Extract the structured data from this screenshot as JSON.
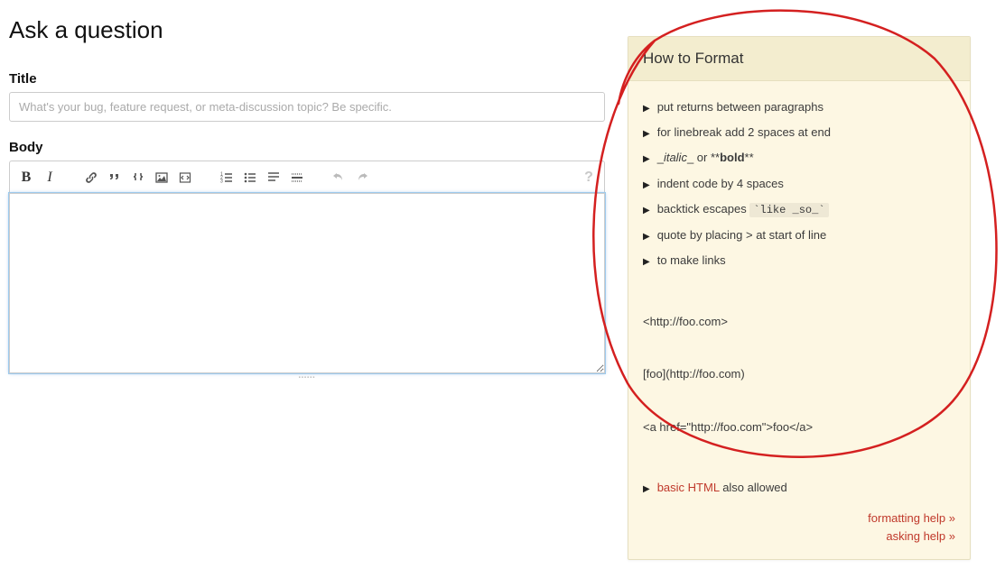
{
  "page": {
    "heading": "Ask a question"
  },
  "title_field": {
    "label": "Title",
    "placeholder": "What's your bug, feature request, or meta-discussion topic? Be specific."
  },
  "body_field": {
    "label": "Body"
  },
  "toolbar": {
    "bold_label": "B",
    "italic_label": "I",
    "help_glyph": "?"
  },
  "help_panel": {
    "title": "How to Format",
    "tips": {
      "t0": "put returns between paragraphs",
      "t1": "for linebreak add 2 spaces at end",
      "t2_pre": "_",
      "t2_italic": "italic",
      "t2_mid": "_ or **",
      "t2_bold": "bold",
      "t2_post": "**",
      "t3": "indent code by 4 spaces",
      "t4_pre": "backtick escapes ",
      "t4_code": "`like _so_`",
      "t5": "quote by placing > at start of line",
      "t6": "to make links",
      "links_example_l1": "<http://foo.com>",
      "links_example_l2": "[foo](http://foo.com)",
      "links_example_l3": "<a href=\"http://foo.com\">foo</a>",
      "t7_link": "basic HTML",
      "t7_rest": " also allowed"
    },
    "footer": {
      "formatting": "formatting help »",
      "asking": "asking help »"
    }
  }
}
